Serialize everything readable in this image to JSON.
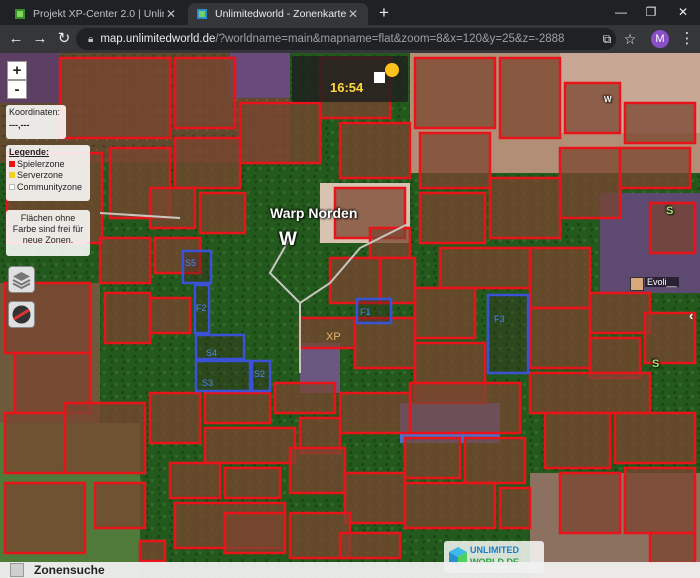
{
  "browser": {
    "tabs": [
      {
        "title": "Projekt XP-Center 2.0 | Unlimitedworld",
        "active": false
      },
      {
        "title": "Unlimitedworld - Zonenkarte",
        "active": true
      }
    ],
    "url_host": "map.unlimitedworld.de",
    "url_rest": "/?worldname=main&mapname=flat&zoom=8&x=120&y=25&z=-2888",
    "avatar_letter": "M"
  },
  "map": {
    "zoom_in": "+",
    "zoom_out": "-",
    "coords_label": "Koordinaten:",
    "coords_value": "---,---",
    "legend": {
      "title": "Legende:",
      "items": [
        {
          "label": "Spielerzone",
          "color": "#e8141a"
        },
        {
          "label": "Serverzone",
          "color": "#f2d21c"
        },
        {
          "label": "Communityzone",
          "color": "#ffffff"
        }
      ]
    },
    "info_text": "Flächen ohne Farbe sind frei für neue Zonen.",
    "clock_time": "16:54",
    "warp_label": "Warp Norden",
    "warp_letter": "W",
    "zone_labels": [
      "S5",
      "F2",
      "S4",
      "S3",
      "S2",
      "F1",
      "XP",
      "F3"
    ],
    "markers": [
      "S",
      "S",
      "W"
    ],
    "player_name": "Evoli__",
    "brand_line1": "UNLIMITED",
    "brand_line2": "WORLD.DE",
    "search_label": "Zonensuche",
    "colors": {
      "player_zone": "#e8141a",
      "community_zone": "#3a52d6",
      "forest": "#255c1f",
      "dirt": "#6b5034"
    }
  }
}
